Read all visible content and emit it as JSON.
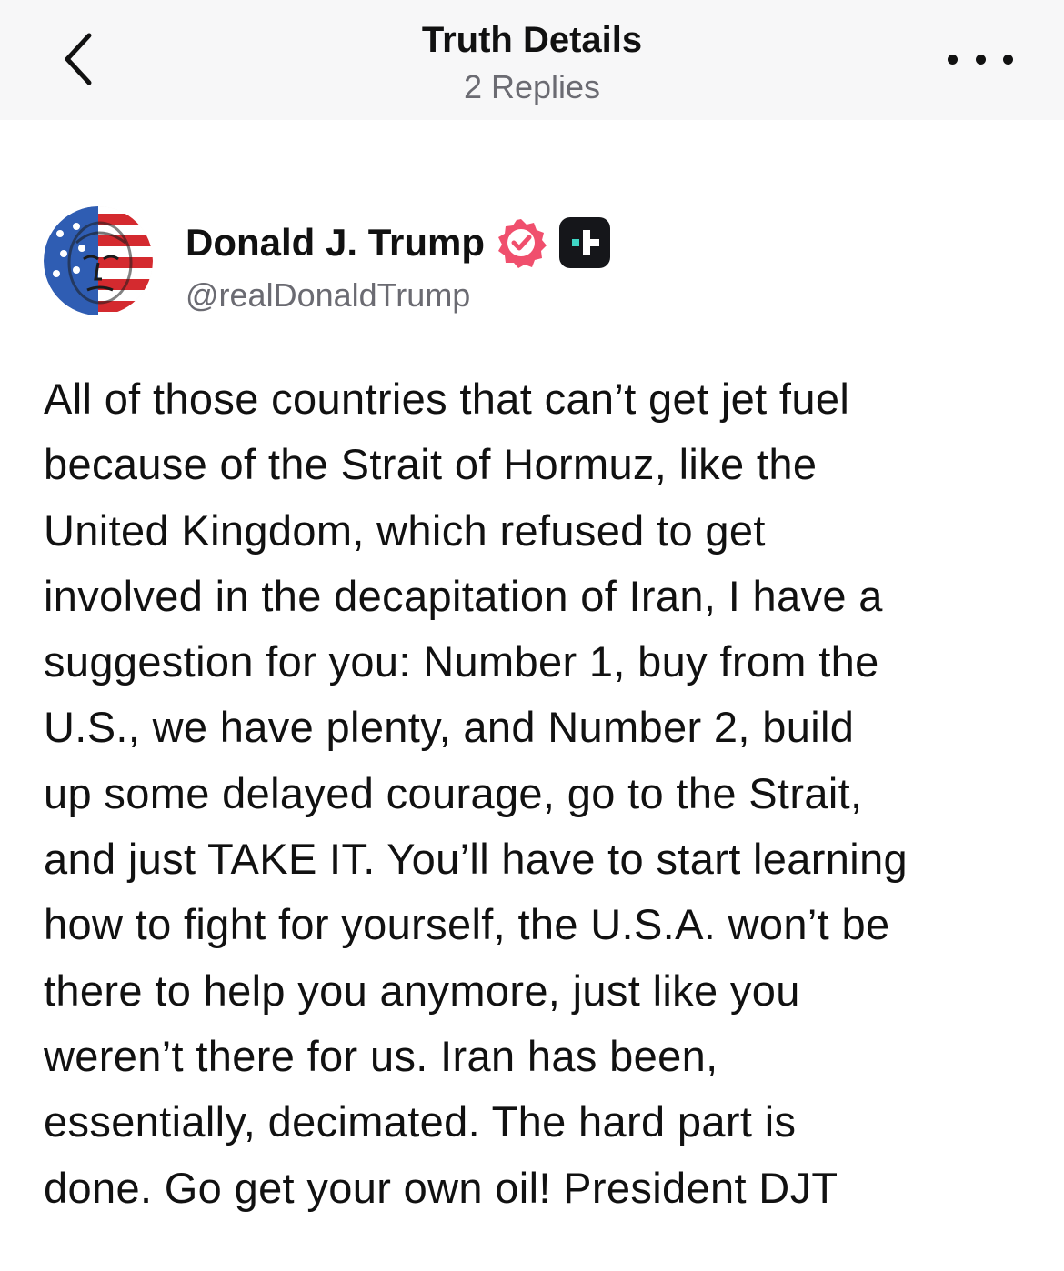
{
  "header": {
    "title": "Truth Details",
    "subtitle": "2 Replies",
    "back_icon": "chevron-left-icon",
    "more_icon": "more-horizontal-icon"
  },
  "author": {
    "display_name": "Donald J. Trump",
    "handle": "@realDonaldTrump",
    "verified_icon": "verified-badge-icon",
    "plus_icon": "truth-plus-badge-icon"
  },
  "post": {
    "lines": [
      "All of those countries that can’t get jet fuel",
      "because of the Strait of Hormuz, like the",
      "United Kingdom, which refused to get",
      "involved in the decapitation of Iran, I have a",
      "suggestion for you: Number 1, buy from the",
      "U.S., we have plenty, and Number 2, build",
      "up some delayed courage, go to the Strait,",
      "and just TAKE IT. You’ll have to start learning",
      "how to fight for yourself, the U.S.A. won’t be",
      "there to help you anymore, just like you",
      "weren’t there for us. Iran has been,",
      "essentially, decimated. The hard part is",
      "done. Go get your own oil! President DJT"
    ]
  },
  "colors": {
    "header_bg": "#f7f7f8",
    "text": "#111111",
    "muted": "#6b6b72",
    "verified": "#f04f6d",
    "plus_badge_bg": "#15161a",
    "plus_badge_accent": "#3fd6c5"
  }
}
